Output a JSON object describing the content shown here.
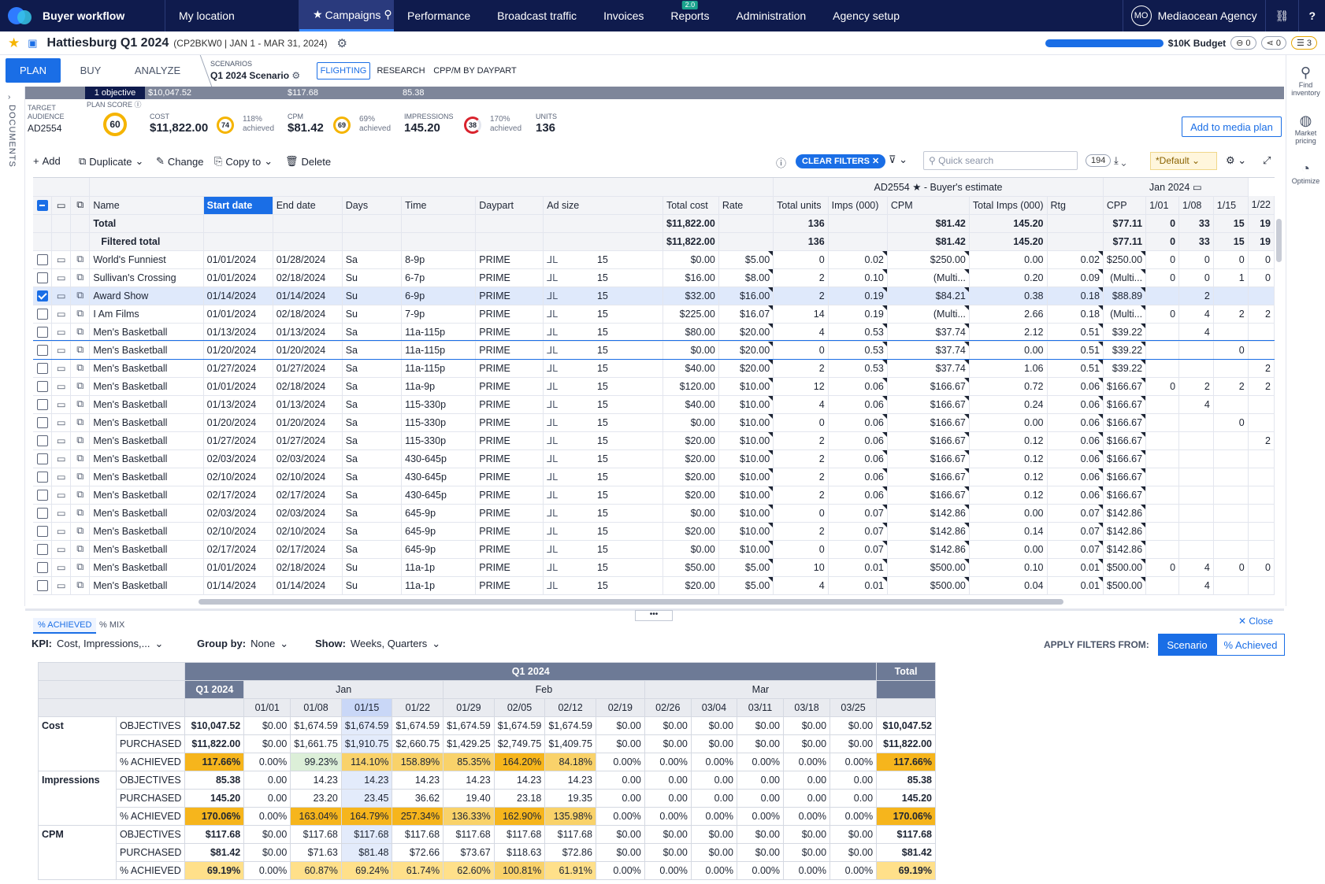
{
  "topnav": {
    "brand": "Buyer workflow",
    "items": [
      "My location",
      "Campaigns",
      "Performance",
      "Broadcast traffic",
      "Invoices",
      "Reports",
      "Administration",
      "Agency setup"
    ],
    "reports_badge": "2.0",
    "avatar": "MO",
    "agency": "Mediaocean Agency"
  },
  "header": {
    "campaign": "Hattiesburg Q1 2024",
    "sub": "(CP2BKW0 | JAN 1 - MAR 31, 2024)",
    "budget": "$10K Budget",
    "pill1": "0",
    "pill2": "0",
    "pill3": "3"
  },
  "tabs": {
    "plan": "PLAN",
    "buy": "BUY",
    "analyze": "ANALYZE",
    "scenarios_label": "SCENARIOS",
    "scenario": "Q1 2024 Scenario",
    "flighting": "FLIGHTING",
    "research": "RESEARCH",
    "cpp": "CPP/M BY DAYPART"
  },
  "sidebar_left": "DOCUMENTS",
  "sidebar_right": {
    "find": "Find inventory",
    "market": "Market pricing",
    "optimize": "Optimize"
  },
  "metrics": {
    "bar": [
      "1 objective",
      "$10,047.52",
      "$117.68",
      "85.38"
    ],
    "target_label": "TARGET AUDIENCE",
    "target": "AD2554",
    "score_label": "PLAN SCORE",
    "score": "60",
    "cost_label": "COST",
    "cost": "$11,822.00",
    "cost_ring": "74",
    "cost_ach": "118%",
    "cost_ach2": "achieved",
    "cpm_label": "CPM",
    "cpm": "$81.42",
    "cpm_ring": "69",
    "cpm_ach": "69%",
    "cpm_ach2": "achieved",
    "imp_label": "IMPRESSIONS",
    "imp": "145.20",
    "imp_ring": "38",
    "imp_ach": "170%",
    "imp_ach2": "achieved",
    "units_label": "UNITS",
    "units": "136",
    "add_btn": "Add to media plan"
  },
  "toolbar": {
    "add": "Add",
    "duplicate": "Duplicate",
    "change": "Change",
    "copy": "Copy to",
    "delete": "Delete",
    "clear": "CLEAR FILTERS",
    "search_ph": "Quick search",
    "count": "194",
    "default": "*Default"
  },
  "grid": {
    "group_header": "AD2554 ★ - Buyer's estimate",
    "month_header": "Jan 2024",
    "cols": [
      "Name",
      "Start date",
      "End date",
      "Days",
      "Time",
      "Daypart",
      "Ad size",
      "Total cost",
      "Rate",
      "Total units",
      "Imps (000)",
      "CPM",
      "Total Imps (000)",
      "Rtg",
      "CPP",
      "1/01",
      "1/08",
      "1/15",
      "1/22"
    ],
    "total": [
      "Total",
      "",
      "",
      "",
      "",
      "",
      "",
      "$11,822.00",
      "",
      "136",
      "",
      "$81.42",
      "145.20",
      "",
      "$77.11",
      "0",
      "33",
      "15",
      "19"
    ],
    "filtered": [
      "Filtered total",
      "",
      "",
      "",
      "",
      "",
      "",
      "$11,822.00",
      "",
      "136",
      "",
      "$81.42",
      "145.20",
      "",
      "$77.11",
      "0",
      "33",
      "15",
      "19"
    ],
    "rows": [
      [
        "World's Funniest",
        "01/01/2024",
        "01/28/2024",
        "Sa",
        "8-9p",
        "PRIME",
        "15",
        "$0.00",
        "$5.00",
        "0",
        "0.02",
        "$250.00",
        "0.00",
        "0.02",
        "$250.00",
        "0",
        "0",
        "0",
        "0"
      ],
      [
        "Sullivan's Crossing",
        "01/01/2024",
        "02/18/2024",
        "Su",
        "6-7p",
        "PRIME",
        "15",
        "$16.00",
        "$8.00",
        "2",
        "0.10",
        "(Multi...",
        "0.20",
        "0.09",
        "(Multi...",
        "0",
        "0",
        "1",
        "0"
      ],
      [
        "Award Show",
        "01/14/2024",
        "01/14/2024",
        "Su",
        "6-9p",
        "PRIME",
        "15",
        "$32.00",
        "$16.00",
        "2",
        "0.19",
        "$84.21",
        "0.38",
        "0.18",
        "$88.89",
        "",
        "2",
        "",
        ""
      ],
      [
        "I Am Films",
        "01/01/2024",
        "02/18/2024",
        "Su",
        "7-9p",
        "PRIME",
        "15",
        "$225.00",
        "$16.07",
        "14",
        "0.19",
        "(Multi...",
        "2.66",
        "0.18",
        "(Multi...",
        "0",
        "4",
        "2",
        "2"
      ],
      [
        "Men's Basketball",
        "01/13/2024",
        "01/13/2024",
        "Sa",
        "11a-115p",
        "PRIME",
        "15",
        "$80.00",
        "$20.00",
        "4",
        "0.53",
        "$37.74",
        "2.12",
        "0.51",
        "$39.22",
        "",
        "4",
        "",
        ""
      ],
      [
        "Men's Basketball",
        "01/20/2024",
        "01/20/2024",
        "Sa",
        "11a-115p",
        "PRIME",
        "15",
        "$0.00",
        "$20.00",
        "0",
        "0.53",
        "$37.74",
        "0.00",
        "0.51",
        "$39.22",
        "",
        "",
        "0",
        ""
      ],
      [
        "Men's Basketball",
        "01/27/2024",
        "01/27/2024",
        "Sa",
        "11a-115p",
        "PRIME",
        "15",
        "$40.00",
        "$20.00",
        "2",
        "0.53",
        "$37.74",
        "1.06",
        "0.51",
        "$39.22",
        "",
        "",
        "",
        "2"
      ],
      [
        "Men's Basketball",
        "01/01/2024",
        "02/18/2024",
        "Sa",
        "11a-9p",
        "PRIME",
        "15",
        "$120.00",
        "$10.00",
        "12",
        "0.06",
        "$166.67",
        "0.72",
        "0.06",
        "$166.67",
        "0",
        "2",
        "2",
        "2"
      ],
      [
        "Men's Basketball",
        "01/13/2024",
        "01/13/2024",
        "Sa",
        "115-330p",
        "PRIME",
        "15",
        "$40.00",
        "$10.00",
        "4",
        "0.06",
        "$166.67",
        "0.24",
        "0.06",
        "$166.67",
        "",
        "4",
        "",
        ""
      ],
      [
        "Men's Basketball",
        "01/20/2024",
        "01/20/2024",
        "Sa",
        "115-330p",
        "PRIME",
        "15",
        "$0.00",
        "$10.00",
        "0",
        "0.06",
        "$166.67",
        "0.00",
        "0.06",
        "$166.67",
        "",
        "",
        "0",
        ""
      ],
      [
        "Men's Basketball",
        "01/27/2024",
        "01/27/2024",
        "Sa",
        "115-330p",
        "PRIME",
        "15",
        "$20.00",
        "$10.00",
        "2",
        "0.06",
        "$166.67",
        "0.12",
        "0.06",
        "$166.67",
        "",
        "",
        "",
        "2"
      ],
      [
        "Men's Basketball",
        "02/03/2024",
        "02/03/2024",
        "Sa",
        "430-645p",
        "PRIME",
        "15",
        "$20.00",
        "$10.00",
        "2",
        "0.06",
        "$166.67",
        "0.12",
        "0.06",
        "$166.67",
        "",
        "",
        "",
        ""
      ],
      [
        "Men's Basketball",
        "02/10/2024",
        "02/10/2024",
        "Sa",
        "430-645p",
        "PRIME",
        "15",
        "$20.00",
        "$10.00",
        "2",
        "0.06",
        "$166.67",
        "0.12",
        "0.06",
        "$166.67",
        "",
        "",
        "",
        ""
      ],
      [
        "Men's Basketball",
        "02/17/2024",
        "02/17/2024",
        "Sa",
        "430-645p",
        "PRIME",
        "15",
        "$20.00",
        "$10.00",
        "2",
        "0.06",
        "$166.67",
        "0.12",
        "0.06",
        "$166.67",
        "",
        "",
        "",
        ""
      ],
      [
        "Men's Basketball",
        "02/03/2024",
        "02/03/2024",
        "Sa",
        "645-9p",
        "PRIME",
        "15",
        "$0.00",
        "$10.00",
        "0",
        "0.07",
        "$142.86",
        "0.00",
        "0.07",
        "$142.86",
        "",
        "",
        "",
        ""
      ],
      [
        "Men's Basketball",
        "02/10/2024",
        "02/10/2024",
        "Sa",
        "645-9p",
        "PRIME",
        "15",
        "$20.00",
        "$10.00",
        "2",
        "0.07",
        "$142.86",
        "0.14",
        "0.07",
        "$142.86",
        "",
        "",
        "",
        ""
      ],
      [
        "Men's Basketball",
        "02/17/2024",
        "02/17/2024",
        "Sa",
        "645-9p",
        "PRIME",
        "15",
        "$0.00",
        "$10.00",
        "0",
        "0.07",
        "$142.86",
        "0.00",
        "0.07",
        "$142.86",
        "",
        "",
        "",
        ""
      ],
      [
        "Men's Basketball",
        "01/01/2024",
        "02/18/2024",
        "Su",
        "11a-1p",
        "PRIME",
        "15",
        "$50.00",
        "$5.00",
        "10",
        "0.01",
        "$500.00",
        "0.10",
        "0.01",
        "$500.00",
        "0",
        "4",
        "0",
        "0"
      ],
      [
        "Men's Basketball",
        "01/14/2024",
        "01/14/2024",
        "Su",
        "11a-1p",
        "PRIME",
        "15",
        "$20.00",
        "$5.00",
        "4",
        "0.01",
        "$500.00",
        "0.04",
        "0.01",
        "$500.00",
        "",
        "4",
        "",
        ""
      ]
    ],
    "selected_row": 2,
    "edit_row": 5
  },
  "bottom": {
    "tab1": "% ACHIEVED",
    "tab2": "% MIX",
    "close": "Close",
    "kpi_label": "KPI:",
    "kpi": "Cost, Impressions,...",
    "group_label": "Group by:",
    "group": "None",
    "show_label": "Show:",
    "show": "Weeks, Quarters",
    "apply_label": "APPLY FILTERS FROM:",
    "scenario_btn": "Scenario",
    "achieved_btn": "% Achieved",
    "q_header": "Q1 2024",
    "total_header": "Total",
    "q_col": "Q1 2024",
    "months": [
      "Jan",
      "Feb",
      "Mar"
    ],
    "weeks": [
      "01/01",
      "01/08",
      "01/15",
      "01/22",
      "01/29",
      "02/05",
      "02/12",
      "02/19",
      "02/26",
      "03/04",
      "03/11",
      "03/18",
      "03/25"
    ],
    "groups": [
      {
        "name": "Cost",
        "rows": [
          {
            "label": "OBJECTIVES",
            "q": "$10,047.52",
            "w": [
              "$0.00",
              "$1,674.59",
              "$1,674.59",
              "$1,674.59",
              "$1,674.59",
              "$1,674.59",
              "$1,674.59",
              "$0.00",
              "$0.00",
              "$0.00",
              "$0.00",
              "$0.00",
              "$0.00"
            ],
            "t": "$10,047.52"
          },
          {
            "label": "PURCHASED",
            "q": "$11,822.00",
            "w": [
              "$0.00",
              "$1,661.75",
              "$1,910.75",
              "$2,660.75",
              "$1,429.25",
              "$2,749.75",
              "$1,409.75",
              "$0.00",
              "$0.00",
              "$0.00",
              "$0.00",
              "$0.00",
              "$0.00"
            ],
            "t": "$11,822.00"
          },
          {
            "label": "% ACHIEVED",
            "q": "117.66%",
            "w": [
              "0.00%",
              "99.23%",
              "114.10%",
              "158.89%",
              "85.35%",
              "164.20%",
              "84.18%",
              "0.00%",
              "0.00%",
              "0.00%",
              "0.00%",
              "0.00%",
              "0.00%"
            ],
            "t": "117.66%"
          }
        ]
      },
      {
        "name": "Impressions",
        "rows": [
          {
            "label": "OBJECTIVES",
            "q": "85.38",
            "w": [
              "0.00",
              "14.23",
              "14.23",
              "14.23",
              "14.23",
              "14.23",
              "14.23",
              "0.00",
              "0.00",
              "0.00",
              "0.00",
              "0.00",
              "0.00"
            ],
            "t": "85.38"
          },
          {
            "label": "PURCHASED",
            "q": "145.20",
            "w": [
              "0.00",
              "23.20",
              "23.45",
              "36.62",
              "19.40",
              "23.18",
              "19.35",
              "0.00",
              "0.00",
              "0.00",
              "0.00",
              "0.00",
              "0.00"
            ],
            "t": "145.20"
          },
          {
            "label": "% ACHIEVED",
            "q": "170.06%",
            "w": [
              "0.00%",
              "163.04%",
              "164.79%",
              "257.34%",
              "136.33%",
              "162.90%",
              "135.98%",
              "0.00%",
              "0.00%",
              "0.00%",
              "0.00%",
              "0.00%",
              "0.00%"
            ],
            "t": "170.06%"
          }
        ]
      },
      {
        "name": "CPM",
        "rows": [
          {
            "label": "OBJECTIVES",
            "q": "$117.68",
            "w": [
              "$0.00",
              "$117.68",
              "$117.68",
              "$117.68",
              "$117.68",
              "$117.68",
              "$117.68",
              "$0.00",
              "$0.00",
              "$0.00",
              "$0.00",
              "$0.00",
              "$0.00"
            ],
            "t": "$117.68"
          },
          {
            "label": "PURCHASED",
            "q": "$81.42",
            "w": [
              "$0.00",
              "$71.63",
              "$81.48",
              "$72.66",
              "$73.67",
              "$118.63",
              "$72.86",
              "$0.00",
              "$0.00",
              "$0.00",
              "$0.00",
              "$0.00",
              "$0.00"
            ],
            "t": "$81.42"
          },
          {
            "label": "% ACHIEVED",
            "q": "69.19%",
            "w": [
              "0.00%",
              "60.87%",
              "69.24%",
              "61.74%",
              "62.60%",
              "100.81%",
              "61.91%",
              "0.00%",
              "0.00%",
              "0.00%",
              "0.00%",
              "0.00%",
              "0.00%"
            ],
            "t": "69.19%"
          }
        ]
      }
    ]
  }
}
